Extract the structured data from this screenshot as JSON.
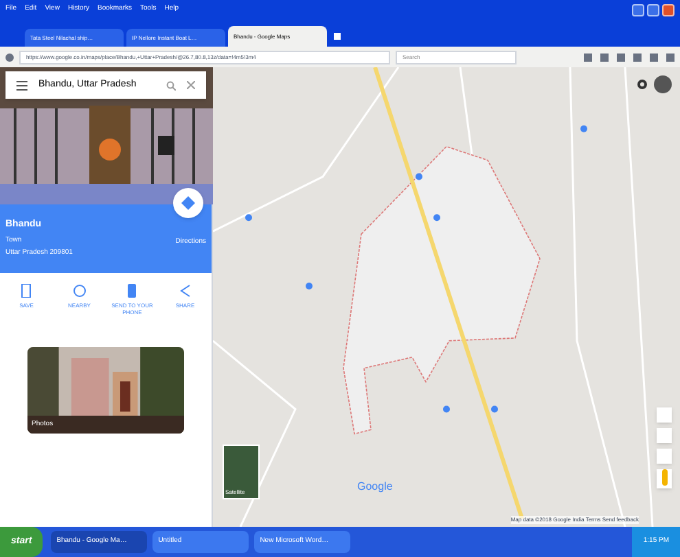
{
  "menu": [
    "File",
    "Edit",
    "View",
    "History",
    "Bookmarks",
    "Tools",
    "Help"
  ],
  "tabs": [
    {
      "label": "Tata Steel Nilachal ship…",
      "selected": false
    },
    {
      "label": "IP Nellore Instant Boat L…",
      "selected": false
    },
    {
      "label": "Bhandu - Google Maps",
      "selected": true
    }
  ],
  "address": {
    "value": "https://www.google.co.in/maps/place/Bhandu,+Uttar+Pradesh/@26.7,80.8,13z/data=!4m5!3m4"
  },
  "search_bar": {
    "placeholder": "Search"
  },
  "sidebar": {
    "search": {
      "value": "Bhandu, Uttar Pradesh"
    },
    "place": {
      "name": "Bhandu",
      "type": "Town",
      "region": "Uttar Pradesh 209801",
      "directions": "Directions"
    },
    "actions": [
      {
        "label": "SAVE",
        "kind": "save"
      },
      {
        "label": "NEARBY",
        "kind": "nearby"
      },
      {
        "label": "SEND TO YOUR PHONE",
        "kind": "phone"
      },
      {
        "label": "SHARE",
        "kind": "share"
      }
    ],
    "photo_card": {
      "label": "Photos"
    }
  },
  "map": {
    "logo": "Google",
    "satellite": "Satellite",
    "footer": "Map data ©2018 Google   India   Terms   Send feedback"
  },
  "taskbar": {
    "start": "start",
    "tasks": [
      {
        "label": "Bhandu - Google Ma…",
        "selected": true
      },
      {
        "label": "Untitled",
        "selected": false
      },
      {
        "label": "New Microsoft Word…",
        "selected": false
      }
    ],
    "clock": "1:15 PM"
  }
}
